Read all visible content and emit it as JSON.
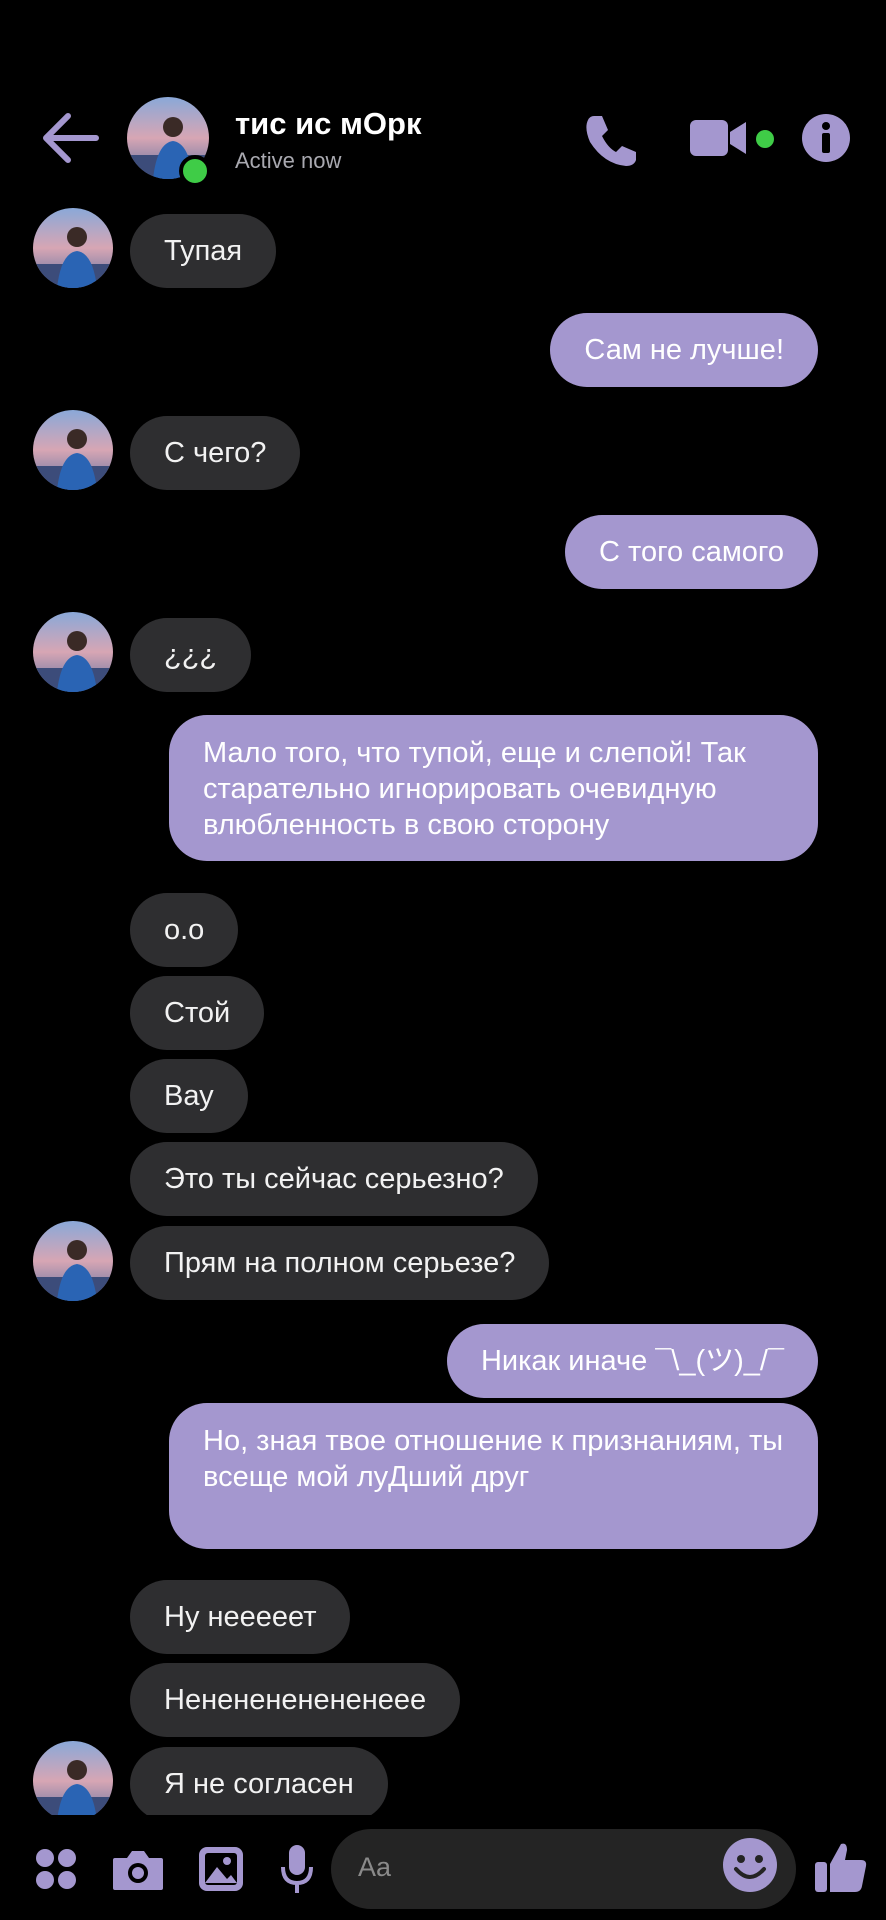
{
  "header": {
    "back_icon": "arrow-left-icon",
    "name": "тис ис мОрк",
    "status": "Active now",
    "accent": "#a497cf",
    "online_color": "#3fcc47"
  },
  "messages": [
    {
      "dir": "in",
      "text": "Тупая"
    },
    {
      "dir": "out",
      "text": "Сам не лучше!"
    },
    {
      "dir": "in",
      "text": "С чего?"
    },
    {
      "dir": "out",
      "text": "С того самого"
    },
    {
      "dir": "in",
      "text": "¿¿¿"
    },
    {
      "dir": "out",
      "text": "Мало того, что тупой, еще и слепой! Так старательно игнорировать очевидную влюбленность в свою сторону"
    },
    {
      "dir": "in",
      "text": "о.о"
    },
    {
      "dir": "in",
      "text": "Стой"
    },
    {
      "dir": "in",
      "text": "Вау"
    },
    {
      "dir": "in",
      "text": "Это ты сейчас серьезно?"
    },
    {
      "dir": "in",
      "text": "Прям на полном серьезе?"
    },
    {
      "dir": "out",
      "text": "Никак иначе ¯\\_(ツ)_/¯"
    },
    {
      "dir": "out",
      "text": "Но, зная твое отношение к признаниям, ты всеще мой луДший друг"
    },
    {
      "dir": "in",
      "text": "Ну нееееет"
    },
    {
      "dir": "in",
      "text": "Нененененененеее"
    },
    {
      "dir": "in",
      "text": "Я не согласен"
    }
  ],
  "composer": {
    "placeholder": "Aa",
    "icons": [
      "apps-icon",
      "camera-icon",
      "gallery-icon",
      "microphone-icon",
      "emoji-icon",
      "thumbs-up-icon"
    ]
  }
}
